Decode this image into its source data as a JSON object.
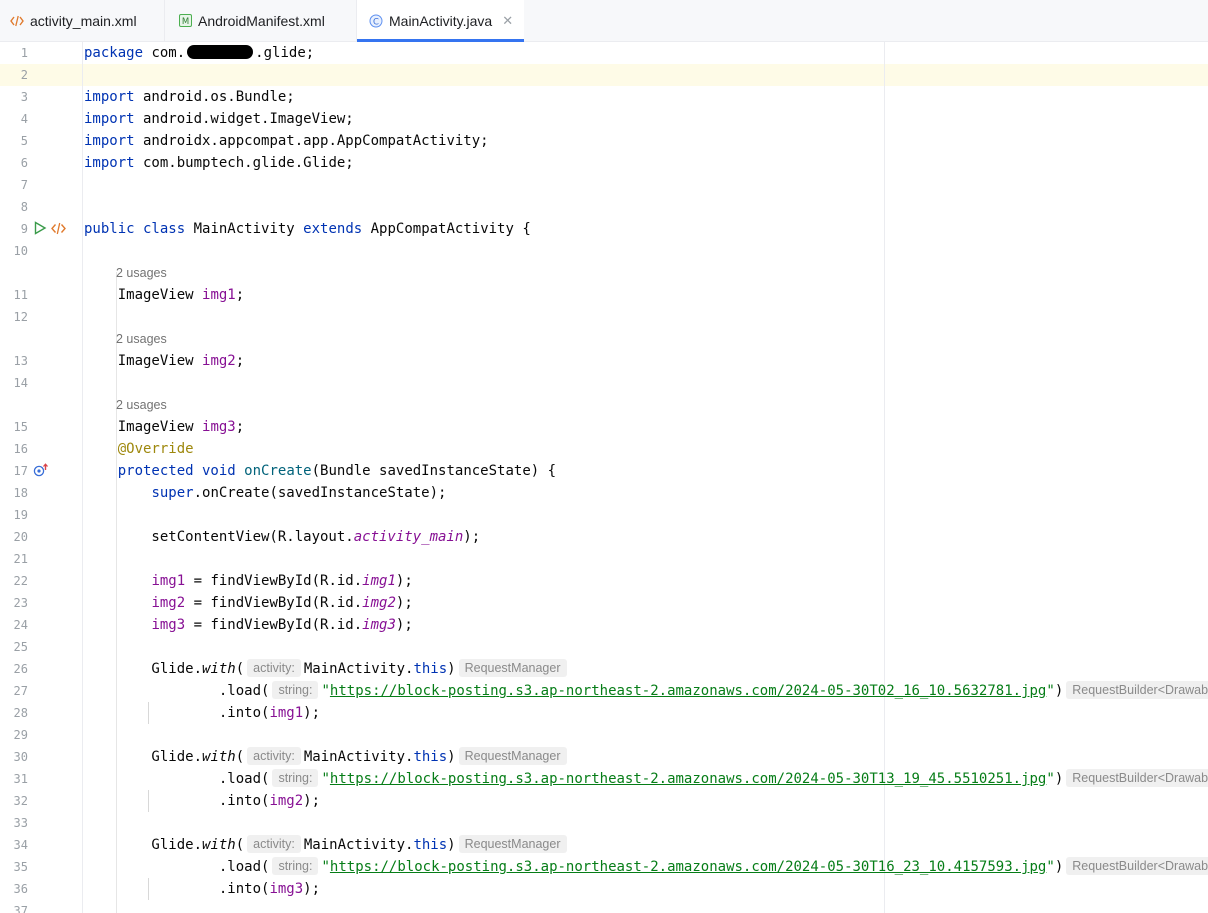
{
  "tabs": [
    {
      "label": "activity_main.xml",
      "icon": "xml-file-icon"
    },
    {
      "label": "AndroidManifest.xml",
      "icon": "manifest-file-icon"
    },
    {
      "label": "MainActivity.java",
      "icon": "java-class-icon",
      "active": true
    }
  ],
  "colors": {
    "keyword": "#0033b3",
    "field": "#871094",
    "method": "#00627a",
    "annotation": "#9e880d",
    "string": "#067d17",
    "active_tab_underline": "#3574f0",
    "current_line": "#fefbe7"
  },
  "usages_label": "2 usages",
  "lines": [
    {
      "n": "1",
      "text": "package com.  .glide;"
    },
    {
      "n": "2",
      "text": ""
    },
    {
      "n": "3",
      "text": "import android.os.Bundle;"
    },
    {
      "n": "4",
      "text": "import android.widget.ImageView;"
    },
    {
      "n": "5",
      "text": "import androidx.appcompat.app.AppCompatActivity;"
    },
    {
      "n": "6",
      "text": "import com.bumptech.glide.Glide;"
    },
    {
      "n": "7",
      "text": ""
    },
    {
      "n": "8",
      "text": ""
    },
    {
      "n": "9",
      "text": "public class MainActivity extends AppCompatActivity {"
    },
    {
      "n": "10",
      "text": ""
    },
    {
      "n": "11",
      "text": "    ImageView img1;"
    },
    {
      "n": "12",
      "text": ""
    },
    {
      "n": "13",
      "text": "    ImageView img2;"
    },
    {
      "n": "14",
      "text": ""
    },
    {
      "n": "15",
      "text": "    ImageView img3;"
    },
    {
      "n": "16",
      "text": "    @Override"
    },
    {
      "n": "17",
      "text": "    protected void onCreate(Bundle savedInstanceState) {"
    },
    {
      "n": "18",
      "text": "        super.onCreate(savedInstanceState);"
    },
    {
      "n": "19",
      "text": ""
    },
    {
      "n": "20",
      "text": "        setContentView(R.layout.activity_main);"
    },
    {
      "n": "21",
      "text": ""
    },
    {
      "n": "22",
      "text": "        img1 = findViewById(R.id.img1);"
    },
    {
      "n": "23",
      "text": "        img2 = findViewById(R.id.img2);"
    },
    {
      "n": "24",
      "text": "        img3 = findViewById(R.id.img3);"
    },
    {
      "n": "25",
      "text": ""
    },
    {
      "n": "26",
      "text": "        Glide.with( MainActivity.this)"
    },
    {
      "n": "27",
      "text": "                .load( \"https://block-posting.s3.ap-northeast-2.amazonaws.com/2024-05-30T02_16_10.5632781.jpg\")"
    },
    {
      "n": "28",
      "text": "                .into(img1);"
    },
    {
      "n": "29",
      "text": ""
    },
    {
      "n": "30",
      "text": "        Glide.with( MainActivity.this)"
    },
    {
      "n": "31",
      "text": "                .load( \"https://block-posting.s3.ap-northeast-2.amazonaws.com/2024-05-30T13_19_45.5510251.jpg\")"
    },
    {
      "n": "32",
      "text": "                .into(img2);"
    },
    {
      "n": "33",
      "text": ""
    },
    {
      "n": "34",
      "text": "        Glide.with( MainActivity.this)"
    },
    {
      "n": "35",
      "text": "                .load( \"https://block-posting.s3.ap-northeast-2.amazonaws.com/2024-05-30T16_23_10.4157593.jpg\")"
    },
    {
      "n": "36",
      "text": "                .into(img3);"
    },
    {
      "n": "37",
      "text": ""
    }
  ],
  "hints": {
    "activity": "activity:",
    "string": "string:",
    "request_manager": "RequestManager",
    "request_builder": "RequestBuilder<Drawable>"
  },
  "urls": {
    "u1": "https://block-posting.s3.ap-northeast-2.amazonaws.com/2024-05-30T02_16_10.5632781.jpg",
    "u2": "https://block-posting.s3.ap-northeast-2.amazonaws.com/2024-05-30T13_19_45.5510251.jpg",
    "u3": "https://block-posting.s3.ap-northeast-2.amazonaws.com/2024-05-30T16_23_10.4157593.jpg"
  },
  "gutter_icons": {
    "line9": [
      "run-icon",
      "layout-link-icon"
    ],
    "line17": [
      "override-method-icon"
    ]
  }
}
